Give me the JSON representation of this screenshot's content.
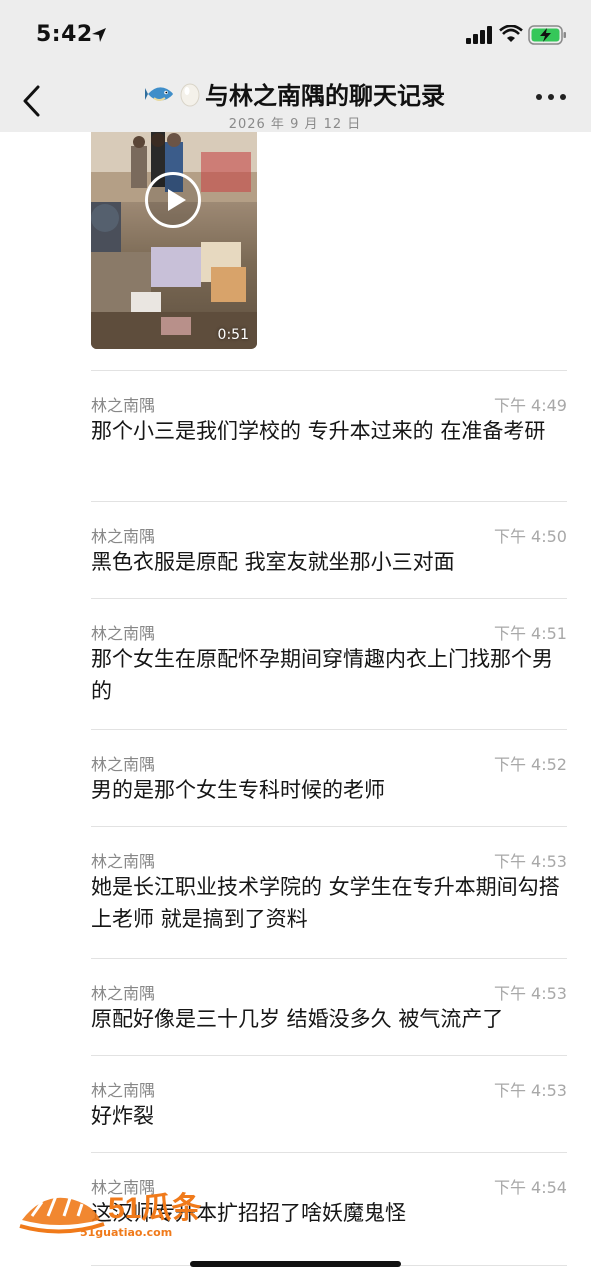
{
  "status_bar": {
    "time": "5:42"
  },
  "header": {
    "title": "与林之南隅的聊天记录",
    "subtitle": "2026 年 9 月 12 日",
    "title_emoji_1": "fish-emoji",
    "title_emoji_2": "egg-emoji"
  },
  "video": {
    "duration": "0:51"
  },
  "messages": [
    {
      "name": "林之南隅",
      "time": "下午 4:49",
      "text": "那个小三是我们学校的 专升本过来的 在准备考研"
    },
    {
      "name": "林之南隅",
      "time": "下午 4:50",
      "text": "黑色衣服是原配 我室友就坐那小三对面"
    },
    {
      "name": "林之南隅",
      "time": "下午 4:51",
      "text": "那个女生在原配怀孕期间穿情趣内衣上门找那个男的"
    },
    {
      "name": "林之南隅",
      "time": "下午 4:52",
      "text": "男的是那个女生专科时候的老师"
    },
    {
      "name": "林之南隅",
      "time": "下午 4:53",
      "text": "她是长江职业技术学院的 女学生在专升本期间勾搭上老师 就是搞到了资料"
    },
    {
      "name": "林之南隅",
      "time": "下午 4:53",
      "text": "原配好像是三十几岁 结婚没多久 被气流产了"
    },
    {
      "name": "林之南隅",
      "time": "下午 4:53",
      "text": "好炸裂"
    },
    {
      "name": "林之南隅",
      "time": "下午 4:54",
      "text": "这汉师专升本扩招招了啥妖魔鬼怪"
    }
  ],
  "watermark": {
    "logo_text": "51瓜条",
    "url": "51guatiao.com"
  },
  "colors": {
    "header_bg": "#ededed",
    "watermark_orange": "#f07a1a"
  }
}
